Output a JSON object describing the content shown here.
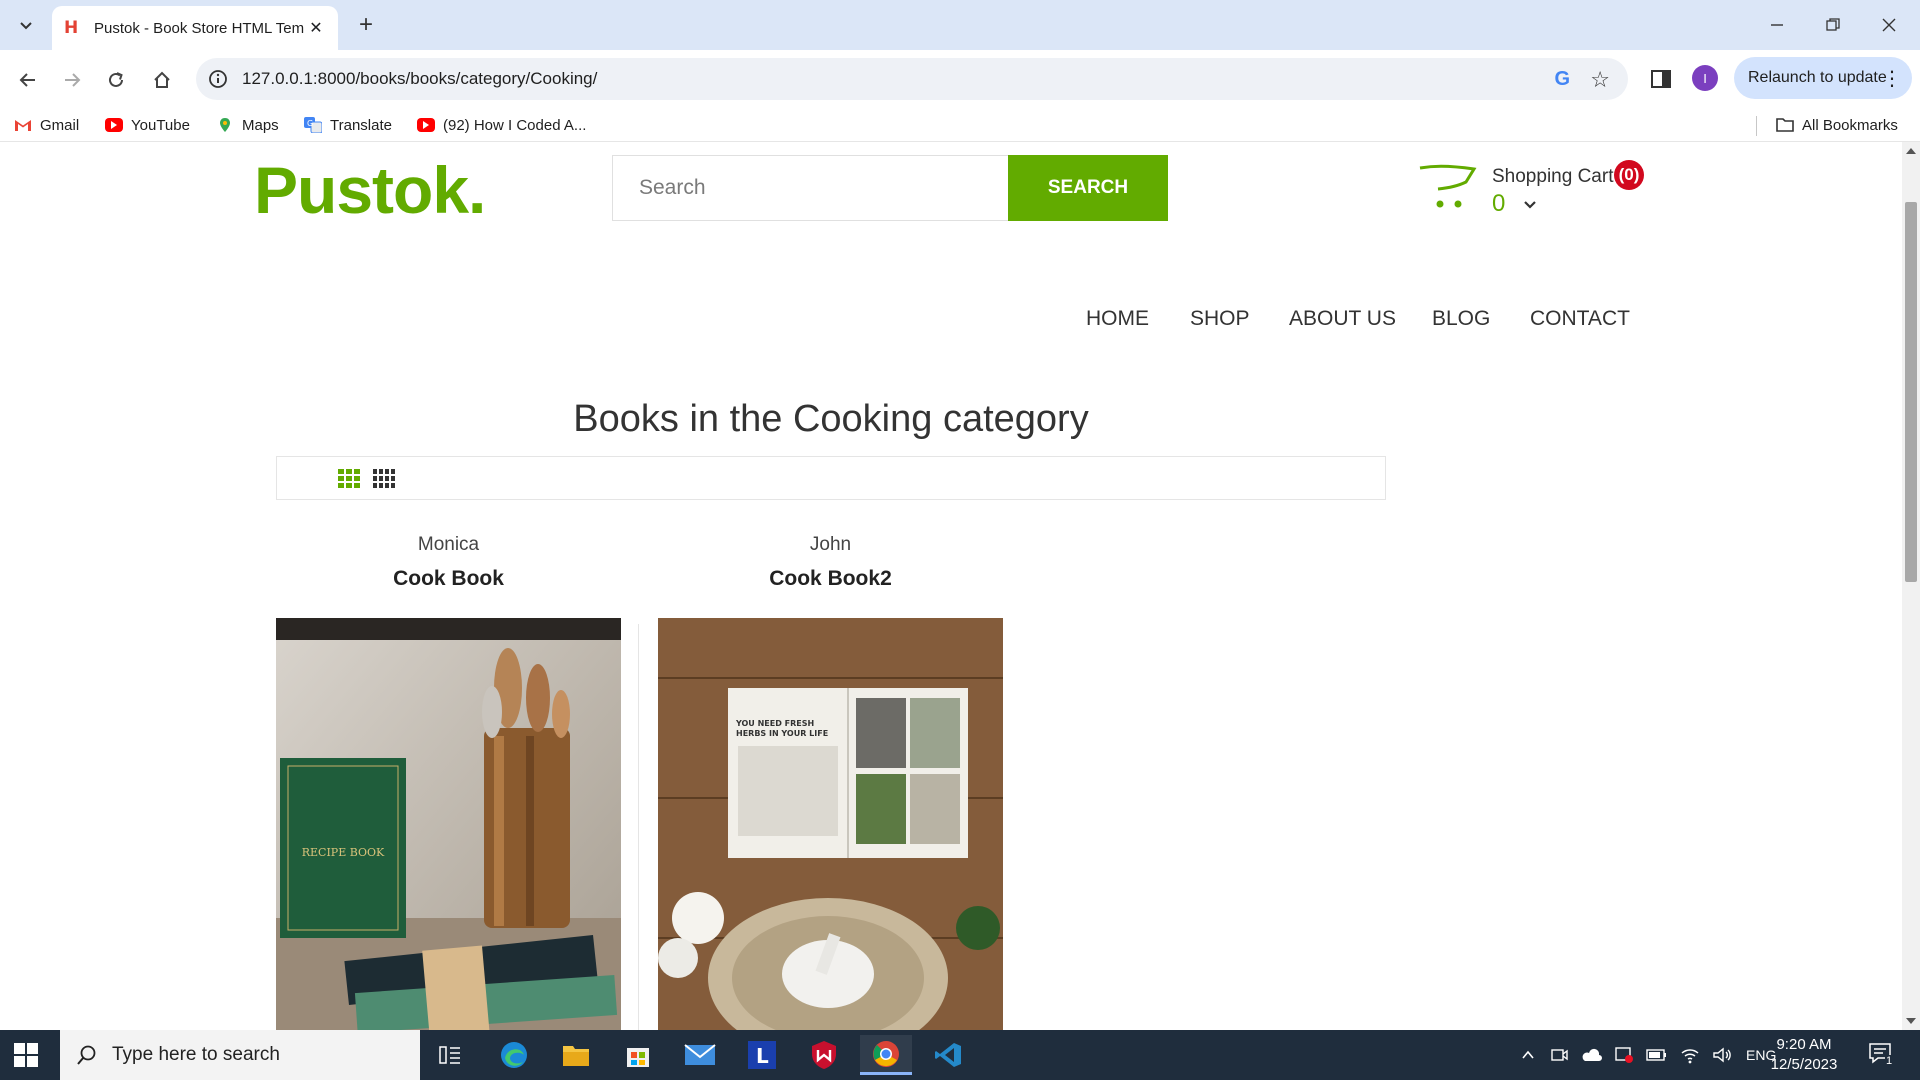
{
  "browser": {
    "tab_title": "Pustok - Book Store HTML Template",
    "url": "127.0.0.1:8000/books/books/category/Cooking/",
    "relaunch_label": "Relaunch to update",
    "profile_initial": "I",
    "bookmarks": [
      {
        "label": "Gmail",
        "icon": "gmail-icon"
      },
      {
        "label": "YouTube",
        "icon": "youtube-icon"
      },
      {
        "label": "Maps",
        "icon": "maps-icon"
      },
      {
        "label": "Translate",
        "icon": "translate-icon"
      },
      {
        "label": "(92) How I Coded A...",
        "icon": "youtube-icon"
      }
    ],
    "all_bookmarks_label": "All Bookmarks"
  },
  "site": {
    "logo": "Pustok.",
    "brand_color": "#62ab00",
    "search": {
      "placeholder": "Search",
      "button_label": "SEARCH"
    },
    "cart": {
      "label": "Shopping Cart",
      "count": "(0)",
      "total": "0"
    },
    "nav": [
      "HOME",
      "SHOP",
      "ABOUT US",
      "BLOG",
      "CONTACT"
    ]
  },
  "page": {
    "title": "Books in the Cooking category",
    "view_modes": [
      "grid-3-view",
      "grid-4-view"
    ],
    "products": [
      {
        "author": "Monica",
        "title": "Cook Book",
        "image": "recipe-book-photo"
      },
      {
        "author": "John",
        "title": "Cook Book2",
        "image": "open-cookbook-photo"
      }
    ]
  },
  "taskbar": {
    "search_placeholder": "Type here to search",
    "language": "ENG",
    "time": "9:20 AM",
    "date": "12/5/2023",
    "notification_count": "1",
    "apps": [
      "task-view-icon",
      "edge-icon",
      "file-explorer-icon",
      "store-icon",
      "mail-icon",
      "l-app-icon",
      "mcafee-icon",
      "chrome-icon",
      "vscode-icon"
    ]
  }
}
